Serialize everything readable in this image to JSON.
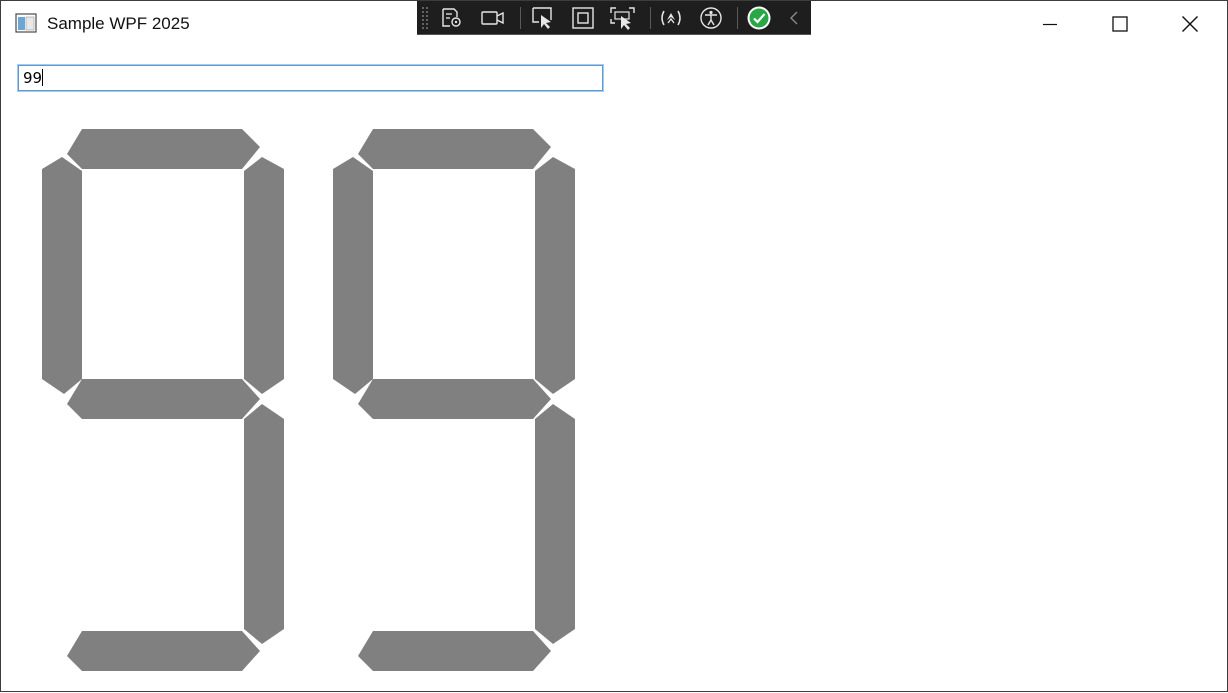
{
  "window": {
    "title": "Sample WPF 2025"
  },
  "caption_buttons": {
    "minimize_icon": "minimize-icon",
    "maximize_icon": "maximize-icon",
    "close_icon": "close-icon"
  },
  "dev_toolbar": {
    "buttons": [
      "go-to-live-visual-tree-icon",
      "record-icon",
      "select-element-icon",
      "display-layout-adorners-icon",
      "track-focused-element-icon",
      "hot-reload-icon",
      "accessibility-checker-icon",
      "binding-failures-check-icon",
      "collapse-chevron-icon"
    ],
    "status_color": "#28a745"
  },
  "input": {
    "value": "99"
  },
  "display": {
    "digits": [
      "9",
      "9"
    ],
    "segment_color": "#808080"
  }
}
